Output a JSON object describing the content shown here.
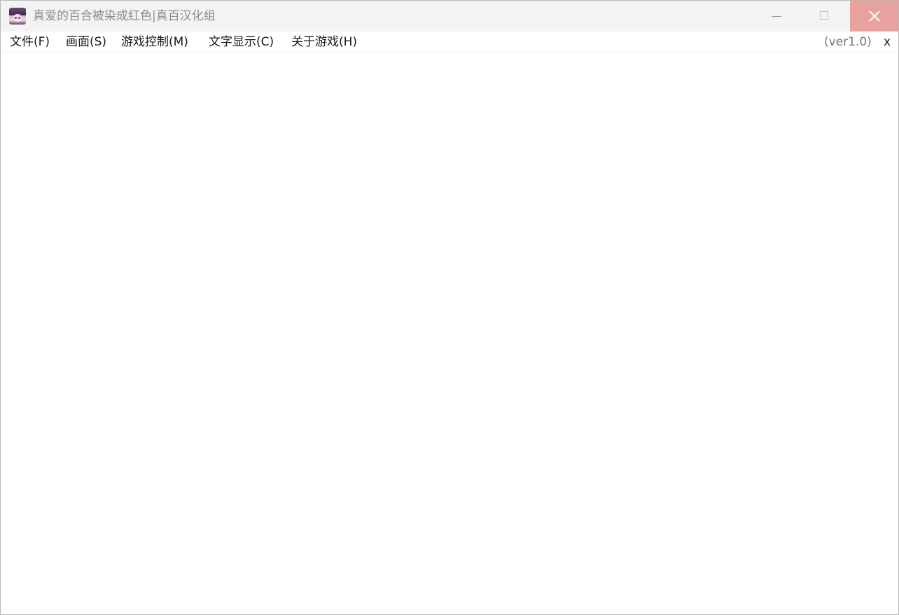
{
  "window": {
    "title": "真爱的百合被染成红色|真百汉化组",
    "icon": "app-character-icon",
    "controls": {
      "minimize_icon": "minimize-icon",
      "maximize_icon": "maximize-icon",
      "close_icon": "close-icon",
      "close_hover_color": "#e8a29d"
    }
  },
  "menubar": {
    "items": [
      {
        "label": "文件(F)"
      },
      {
        "label": "画面(S)"
      },
      {
        "label": "游戏控制(M)"
      },
      {
        "label": "文字显示(C)"
      },
      {
        "label": "关于游戏(H)"
      }
    ],
    "version": "(ver1.0)",
    "close_label": "x"
  },
  "colors": {
    "titlebar_bg": "#f3f3f3",
    "title_text": "#8c8c8c",
    "content_bg": "#ffffff"
  }
}
